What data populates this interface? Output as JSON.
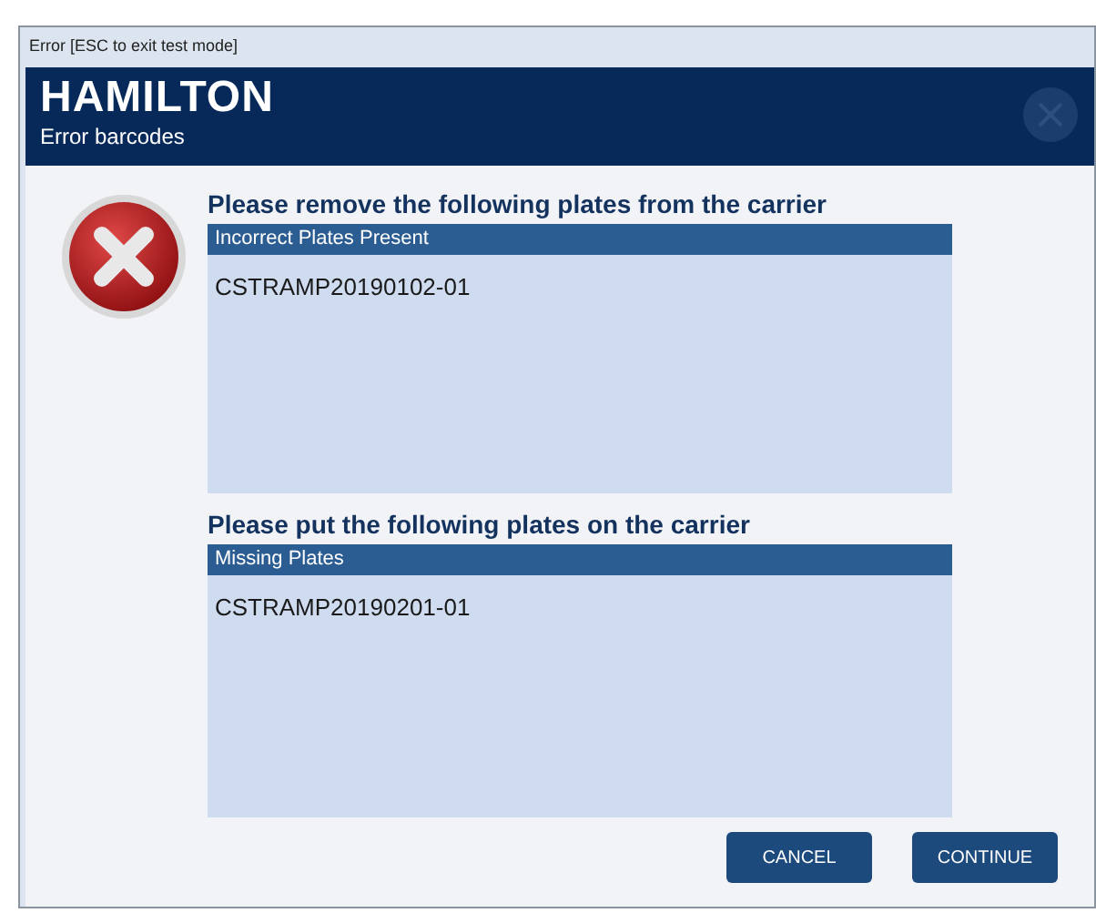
{
  "window": {
    "title": "Error [ESC to exit test mode]"
  },
  "header": {
    "logo": "HAMILTON",
    "subtitle": "Error barcodes"
  },
  "sections": [
    {
      "heading": "Please remove the following plates from the carrier",
      "list_title": "Incorrect Plates Present",
      "items": [
        "CSTRAMP20190102-01"
      ]
    },
    {
      "heading": "Please put the following plates on the carrier",
      "list_title": "Missing Plates",
      "items": [
        "CSTRAMP20190201-01"
      ]
    }
  ],
  "buttons": [
    "CANCEL",
    "CONTINUE"
  ]
}
